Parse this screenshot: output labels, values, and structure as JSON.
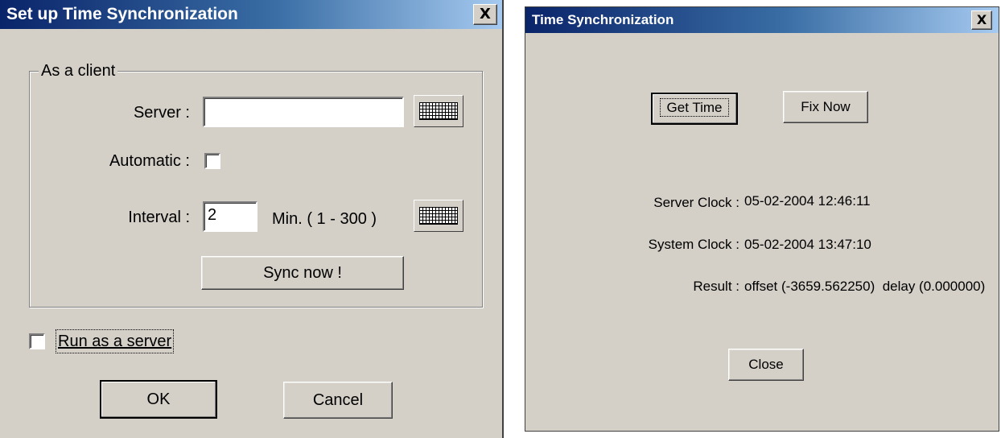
{
  "setup_dialog": {
    "title": "Set up Time Synchronization",
    "close_glyph": "X",
    "group_label": "As a client",
    "server_label": "Server :",
    "server_value": "",
    "automatic_label": "Automatic :",
    "automatic_checked": false,
    "interval_label": "Interval :",
    "interval_value": "2",
    "interval_range": "Min. ( 1 - 300 )",
    "sync_button": "Sync now !",
    "run_server_label": "Run as a server",
    "run_server_checked": false,
    "ok_button": "OK",
    "cancel_button": "Cancel"
  },
  "sync_dialog": {
    "title": "Time Synchronization",
    "close_glyph": "X",
    "get_time_button": "Get Time",
    "fix_now_button": "Fix Now",
    "server_clock_label": "Server Clock :",
    "server_clock_value": "05-02-2004 12:46:11",
    "system_clock_label": "System Clock :",
    "system_clock_value": "05-02-2004 13:47:10",
    "result_label": "Result :",
    "result_value": "offset (-3659.562250)  delay (0.000000)",
    "close_button": "Close"
  },
  "icons": [
    "keyboard-icon",
    "close-icon",
    "checkbox-icon"
  ],
  "colors": {
    "dialog_face": "#d4d0c8",
    "titlebar_start": "#0a246a",
    "titlebar_end": "#a6caf0",
    "title_text": "#ffffff"
  }
}
